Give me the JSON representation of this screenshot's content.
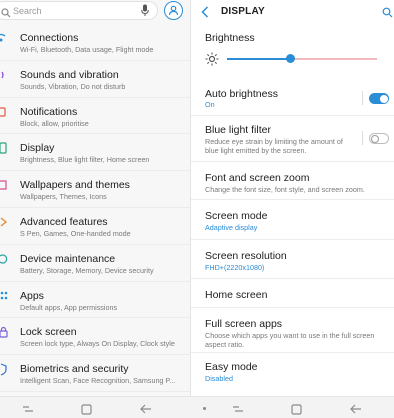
{
  "left": {
    "search_placeholder": "Search",
    "items": [
      {
        "icon": "connections-icon",
        "title": "Connections",
        "subtitle": "Wi-Fi, Bluetooth, Data usage, Flight mode"
      },
      {
        "icon": "sound-icon",
        "title": "Sounds and vibration",
        "subtitle": "Sounds, Vibration, Do not disturb"
      },
      {
        "icon": "notifications-icon",
        "title": "Notifications",
        "subtitle": "Block, allow, prioritise"
      },
      {
        "icon": "display-icon",
        "title": "Display",
        "subtitle": "Brightness, Blue light filter, Home screen"
      },
      {
        "icon": "wallpaper-icon",
        "title": "Wallpapers and themes",
        "subtitle": "Wallpapers, Themes, Icons"
      },
      {
        "icon": "advanced-features-icon",
        "title": "Advanced features",
        "subtitle": "S Pen, Games, One-handed mode"
      },
      {
        "icon": "device-maintenance-icon",
        "title": "Device maintenance",
        "subtitle": "Battery, Storage, Memory, Device security"
      },
      {
        "icon": "apps-icon",
        "title": "Apps",
        "subtitle": "Default apps, App permissions"
      },
      {
        "icon": "lock-screen-icon",
        "title": "Lock screen",
        "subtitle": "Screen lock type, Always On Display, Clock style"
      },
      {
        "icon": "biometrics-icon",
        "title": "Biometrics and security",
        "subtitle": "Intelligent Scan, Face Recognition, Samsung P..."
      }
    ]
  },
  "right": {
    "header_title": "DISPLAY",
    "brightness_label": "Brightness",
    "brightness_level": 0.42,
    "items": {
      "auto_brightness": {
        "title": "Auto brightness",
        "subtitle": "On",
        "toggle": true
      },
      "blue_light": {
        "title": "Blue light filter",
        "subtitle": "Reduce eye strain by limiting the amount of blue light emitted by the screen.",
        "toggle": false
      },
      "font_zoom": {
        "title": "Font and screen zoom",
        "subtitle": "Change the font size, font style, and screen zoom."
      },
      "screen_mode": {
        "title": "Screen mode",
        "subtitle": "Adaptive display"
      },
      "screen_resolution": {
        "title": "Screen resolution",
        "subtitle": "FHD+(2220x1080)"
      },
      "home_screen": {
        "title": "Home screen"
      },
      "full_screen_apps": {
        "title": "Full screen apps",
        "subtitle": "Choose which apps you want to use in the full screen aspect ratio."
      },
      "easy_mode": {
        "title": "Easy mode",
        "subtitle": "Disabled"
      }
    }
  },
  "colors": {
    "accent": "#2a8dd6",
    "track_inactive": "#f0b9bd"
  }
}
